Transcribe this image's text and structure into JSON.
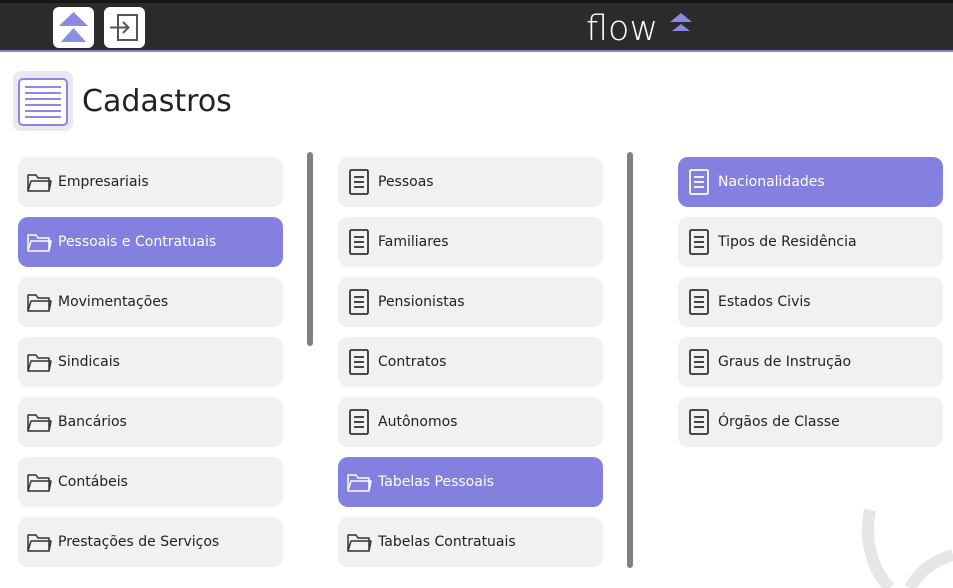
{
  "header": {
    "logo_text": "flow",
    "home_icon": "upload-triangle-icon",
    "exit_icon": "login-arrow-icon",
    "background": "#2b2b2b",
    "accent": "#7f86d6"
  },
  "page": {
    "title": "Cadastros",
    "icon": "list-document-icon"
  },
  "categories": [
    {
      "label": "Empresariais",
      "icon": "folder-icon",
      "active": false
    },
    {
      "label": "Pessoais e Contratuais",
      "icon": "folder-icon",
      "active": true
    },
    {
      "label": "Movimentações",
      "icon": "folder-icon",
      "active": false
    },
    {
      "label": "Sindicais",
      "icon": "folder-icon",
      "active": false
    },
    {
      "label": "Bancários",
      "icon": "folder-icon",
      "active": false
    },
    {
      "label": "Contábeis",
      "icon": "folder-icon",
      "active": false
    },
    {
      "label": "Prestações de Serviços",
      "icon": "folder-icon",
      "active": false
    }
  ],
  "subcategories": [
    {
      "label": "Pessoas",
      "icon": "document-icon",
      "active": false
    },
    {
      "label": "Familiares",
      "icon": "document-icon",
      "active": false
    },
    {
      "label": "Pensionistas",
      "icon": "document-icon",
      "active": false
    },
    {
      "label": "Contratos",
      "icon": "document-icon",
      "active": false
    },
    {
      "label": "Autônomos",
      "icon": "document-icon",
      "active": false
    },
    {
      "label": "Tabelas Pessoais",
      "icon": "folder-icon",
      "active": true
    },
    {
      "label": "Tabelas Contratuais",
      "icon": "folder-icon",
      "active": false
    }
  ],
  "tables": [
    {
      "label": "Nacionalidades",
      "icon": "document-icon",
      "active": true
    },
    {
      "label": "Tipos de Residência",
      "icon": "document-icon",
      "active": false
    },
    {
      "label": "Estados Civis",
      "icon": "document-icon",
      "active": false
    },
    {
      "label": "Graus de Instrução",
      "icon": "document-icon",
      "active": false
    },
    {
      "label": "Órgãos de Classe",
      "icon": "document-icon",
      "active": false
    }
  ],
  "colors": {
    "active": "#8480e0",
    "item_bg": "#f1f1f1"
  }
}
